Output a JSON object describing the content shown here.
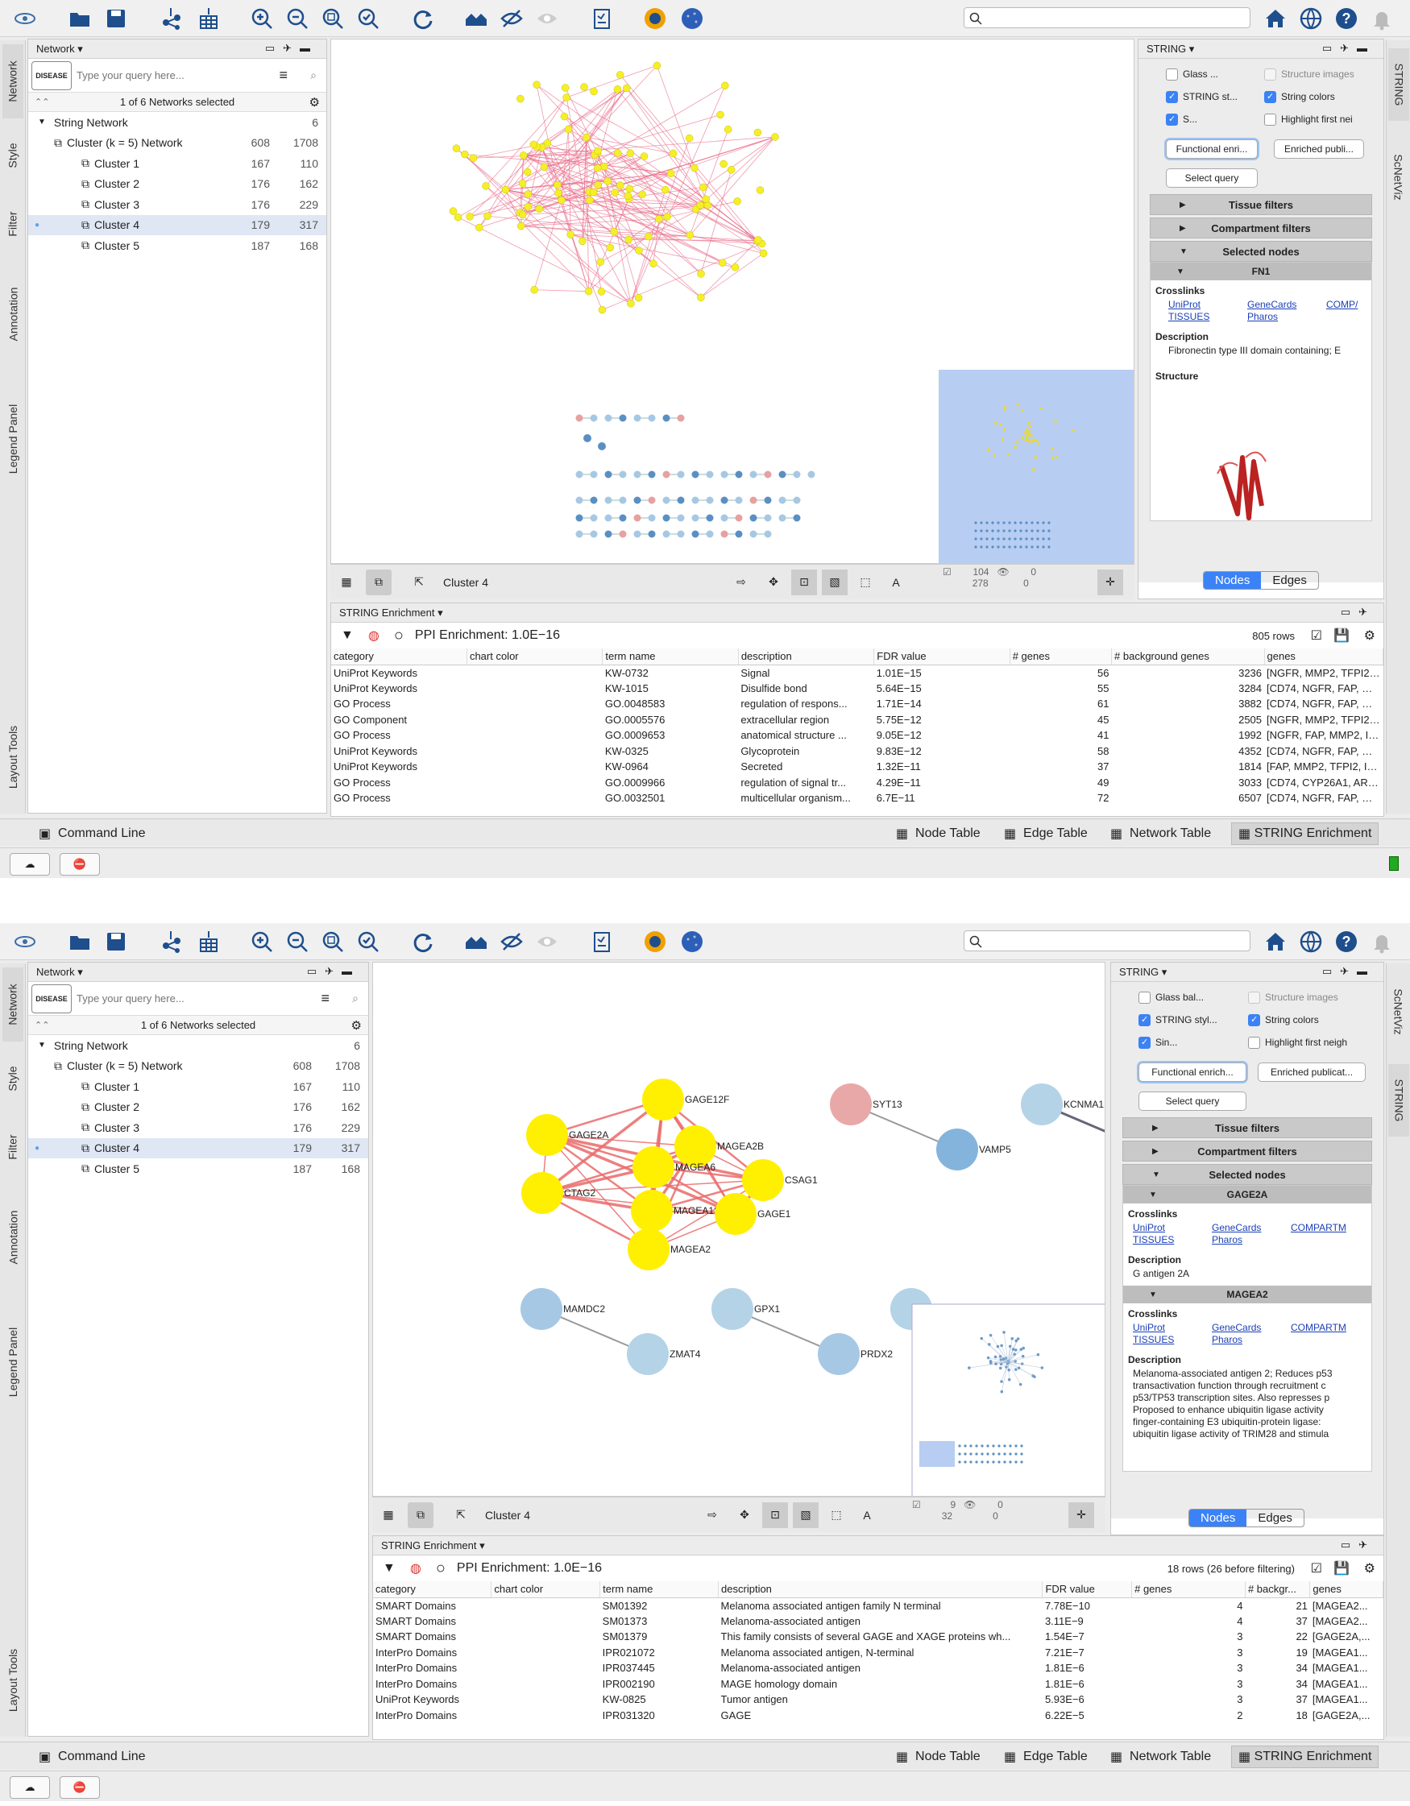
{
  "toolbar": {
    "search_placeholder": "",
    "icons": [
      "cytoscape-logo-icon",
      "open-folder-icon",
      "save-icon",
      "import-network-icon",
      "import-table-icon",
      "zoom-in-icon",
      "zoom-out-icon",
      "zoom-fit-icon",
      "zoom-selected-icon",
      "refresh-icon",
      "home-network-icon",
      "hide-icon",
      "show-icon",
      "report-icon",
      "string-app-icon",
      "globe-app-icon",
      "home-icon",
      "web-icon",
      "help-icon",
      "notification-icon"
    ]
  },
  "left_tabs": [
    "Network",
    "Style",
    "Filter",
    "Annotation",
    "Legend Panel",
    "Layout Tools"
  ],
  "right_tabs_1": [
    "STRING",
    "ScNetViz"
  ],
  "right_tabs_2": [
    "ScNetViz",
    "STRING"
  ],
  "network_panel": {
    "title": "Network",
    "query_placeholder": "Type your query here...",
    "logo_text": "DISEASE",
    "selection_text": "1 of 6 Networks selected",
    "root": {
      "name": "String Network",
      "count": "6"
    },
    "collection": {
      "name": "Cluster (k = 5) Network",
      "nodes": "608",
      "edges": "1708"
    },
    "clusters": [
      {
        "name": "Cluster 1",
        "nodes": "167",
        "edges": "110"
      },
      {
        "name": "Cluster 2",
        "nodes": "176",
        "edges": "162"
      },
      {
        "name": "Cluster 3",
        "nodes": "176",
        "edges": "229"
      },
      {
        "name": "Cluster 4",
        "nodes": "179",
        "edges": "317"
      },
      {
        "name": "Cluster 5",
        "nodes": "187",
        "edges": "168"
      }
    ]
  },
  "network_toolbar": {
    "network_name": "Cluster 4"
  },
  "shot1": {
    "counts": {
      "nodes": "104",
      "edges": "278",
      "sel_nodes": "0",
      "sel_edges": "0"
    },
    "string_panel": {
      "title": "STRING",
      "glass": "Glass ...",
      "structure_images": "Structure images",
      "string_style": "STRING st...",
      "string_colors": "String colors",
      "single": "S...",
      "highlight": "Highlight first nei",
      "functional": "Functional enri...",
      "publications": "Enriched publi...",
      "select_query": "Select query",
      "tissue": "Tissue filters",
      "compartment": "Compartment filters",
      "selected_nodes": "Selected nodes",
      "node": "FN1",
      "crosslinks": "Crosslinks",
      "links": [
        "UniProt",
        "GeneCards",
        "COMP/",
        "TISSUES",
        "Pharos"
      ],
      "description_label": "Description",
      "description": "Fibronectin type III domain containing; E",
      "structure_label": "Structure",
      "nodes_tab": "Nodes",
      "edges_tab": "Edges"
    },
    "enrichment": {
      "title": "STRING Enrichment",
      "ppi": "PPI Enrichment: 1.0E−16",
      "rows": "805 rows",
      "headers": [
        "category",
        "chart color",
        "term name",
        "description",
        "FDR value",
        "# genes",
        "# background genes",
        "genes"
      ],
      "data": [
        [
          "UniProt Keywords",
          "",
          "KW-0732",
          "Signal",
          "1.01E−15",
          "56",
          "3236",
          "[NGFR, MMP2, TFPI2, I..."
        ],
        [
          "UniProt Keywords",
          "",
          "KW-1015",
          "Disulfide bond",
          "5.64E−15",
          "55",
          "3284",
          "[CD74, NGFR, FAP, MM..."
        ],
        [
          "GO Process",
          "",
          "GO.0048583",
          "regulation of respons...",
          "1.71E−14",
          "61",
          "3882",
          "[CD74, NGFR, FAP, MM..."
        ],
        [
          "GO Component",
          "",
          "GO.0005576",
          "extracellular region",
          "5.75E−12",
          "45",
          "2505",
          "[NGFR, MMP2, TFPI2, TF..."
        ],
        [
          "GO Process",
          "",
          "GO.0009653",
          "anatomical structure ...",
          "9.05E−12",
          "41",
          "1992",
          "[NGFR, FAP, MMP2, IGF..."
        ],
        [
          "UniProt Keywords",
          "",
          "KW-0325",
          "Glycoprotein",
          "9.83E−12",
          "58",
          "4352",
          "[CD74, NGFR, FAP, MM..."
        ],
        [
          "UniProt Keywords",
          "",
          "KW-0964",
          "Secreted",
          "1.32E−11",
          "37",
          "1814",
          "[FAP, MMP2, TFPI2, IGF..."
        ],
        [
          "GO Process",
          "",
          "GO.0009966",
          "regulation of signal tr...",
          "4.29E−11",
          "49",
          "3033",
          "[CD74, CYP26A1, ARH..."
        ],
        [
          "GO Process",
          "",
          "GO.0032501",
          "multicellular organism...",
          "6.7E−11",
          "72",
          "6507",
          "[CD74, NGFR, FAP, MM..."
        ]
      ]
    }
  },
  "shot2": {
    "counts": {
      "nodes": "9",
      "edges": "32",
      "sel_nodes": "0",
      "sel_edges": "0"
    },
    "string_panel": {
      "title": "STRING",
      "glass": "Glass bal...",
      "structure_images": "Structure images",
      "string_style": "STRING styl...",
      "string_colors": "String colors",
      "single": "Sin...",
      "highlight": "Highlight first neigh",
      "functional": "Functional enrich...",
      "publications": "Enriched publicat...",
      "select_query": "Select query",
      "tissue": "Tissue filters",
      "compartment": "Compartment filters",
      "selected_nodes": "Selected nodes",
      "node1": "GAGE2A",
      "node1_desc": "G antigen 2A",
      "node2": "MAGEA2",
      "node2_desc": [
        "Melanoma-associated antigen 2; Reduces p53",
        "transactivation function through recruitment c",
        "p53/TP53 transcription sites. Also represses p",
        "Proposed to enhance ubiquitin ligase activity",
        "finger-containing E3 ubiquitin-protein ligase:",
        "ubiquitin ligase activity of TRIM28 and stimula"
      ],
      "crosslinks": "Crosslinks",
      "links": [
        "UniProt",
        "GeneCards",
        "COMPARTM",
        "TISSUES",
        "Pharos"
      ],
      "description_label": "Description",
      "nodes_tab": "Nodes",
      "edges_tab": "Edges"
    },
    "graph_labels": {
      "GAGE12F": "GAGE12F",
      "GAGE2A": "GAGE2A",
      "MAGEA2B": "MAGEA2B",
      "MAGEA6": "MAGEA6",
      "CSAG1": "CSAG1",
      "CTAG2": "CTAG2",
      "MAGEA12": "MAGEA12",
      "GAGE1": "GAGE1",
      "MAGEA2": "MAGEA2",
      "SYT13": "SYT13",
      "VAMP5": "VAMP5",
      "KCNMA1": "KCNMA1",
      "MAMDC2": "MAMDC2",
      "ZMAT4": "ZMAT4",
      "GPX1": "GPX1",
      "PRDX2": "PRDX2"
    },
    "enrichment": {
      "title": "STRING Enrichment",
      "ppi": "PPI Enrichment: 1.0E−16",
      "rows": "18 rows (26 before filtering)",
      "headers": [
        "category",
        "chart color",
        "term name",
        "description",
        "FDR value",
        "# genes",
        "# backgr...",
        "genes"
      ],
      "data": [
        [
          "SMART Domains",
          "",
          "SM01392",
          "Melanoma associated antigen family N terminal",
          "7.78E−10",
          "4",
          "21",
          "[MAGEA2..."
        ],
        [
          "SMART Domains",
          "",
          "SM01373",
          "Melanoma-associated antigen",
          "3.11E−9",
          "4",
          "37",
          "[MAGEA2..."
        ],
        [
          "SMART Domains",
          "",
          "SM01379",
          "This family consists of several GAGE and XAGE proteins wh...",
          "1.54E−7",
          "3",
          "22",
          "[GAGE2A,..."
        ],
        [
          "InterPro Domains",
          "",
          "IPR021072",
          "Melanoma associated antigen, N-terminal",
          "7.21E−7",
          "3",
          "19",
          "[MAGEA1..."
        ],
        [
          "InterPro Domains",
          "",
          "IPR037445",
          "Melanoma-associated antigen",
          "1.81E−6",
          "3",
          "34",
          "[MAGEA1..."
        ],
        [
          "InterPro Domains",
          "",
          "IPR002190",
          "MAGE homology domain",
          "1.81E−6",
          "3",
          "34",
          "[MAGEA1..."
        ],
        [
          "UniProt Keywords",
          "",
          "KW-0825",
          "Tumor antigen",
          "5.93E−6",
          "3",
          "37",
          "[MAGEA1..."
        ],
        [
          "InterPro Domains",
          "",
          "IPR031320",
          "GAGE",
          "6.22E−5",
          "2",
          "18",
          "[GAGE2A,..."
        ]
      ]
    }
  },
  "bottom_tabs": {
    "command_line": "Command Line",
    "node_table": "Node Table",
    "edge_table": "Edge Table",
    "network_table": "Network Table",
    "string_enrichment": "STRING Enrichment"
  }
}
